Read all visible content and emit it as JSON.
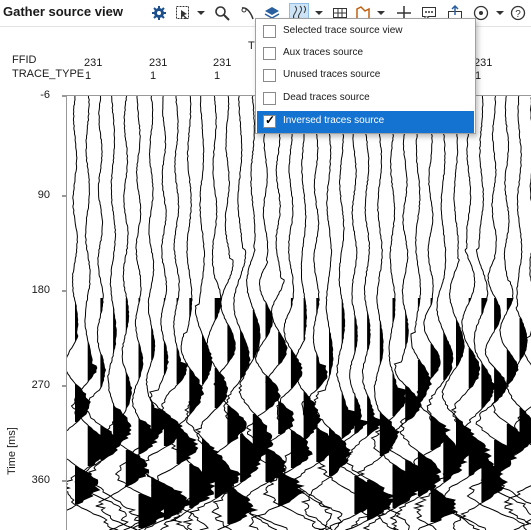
{
  "window": {
    "title": "Gather source view"
  },
  "toolbar": {
    "icons": [
      "gear-icon",
      "pointer-select-icon",
      "zoom-icon",
      "pan-icon",
      "layers-icon",
      "wiggle-icon",
      "grid-icon",
      "pick-icon",
      "crosshair-icon",
      "comment-icon",
      "export-icon",
      "navigate-icon",
      "help-icon"
    ],
    "partial_header": "T"
  },
  "headers": {
    "labels": [
      "FFID",
      "TRACE_TYPE"
    ],
    "ffid_values": [
      "231",
      "231",
      "231",
      "231"
    ],
    "trace_type_values": [
      "1",
      "1",
      "1",
      "1"
    ]
  },
  "axis": {
    "ylabel": "Time [ms]",
    "ticks": [
      "-6",
      "90",
      "180",
      "270",
      "360"
    ]
  },
  "menu": {
    "items": [
      {
        "label": "Selected trace source view",
        "checked": false
      },
      {
        "label": "Aux traces source",
        "checked": false
      },
      {
        "label": "Unused traces source",
        "checked": false
      },
      {
        "label": "Dead traces source",
        "checked": false
      },
      {
        "label": "Inversed traces source",
        "checked": true
      }
    ]
  },
  "colors": {
    "accent": "#1473d1",
    "trace": "#000000",
    "background": "#ffffff"
  }
}
